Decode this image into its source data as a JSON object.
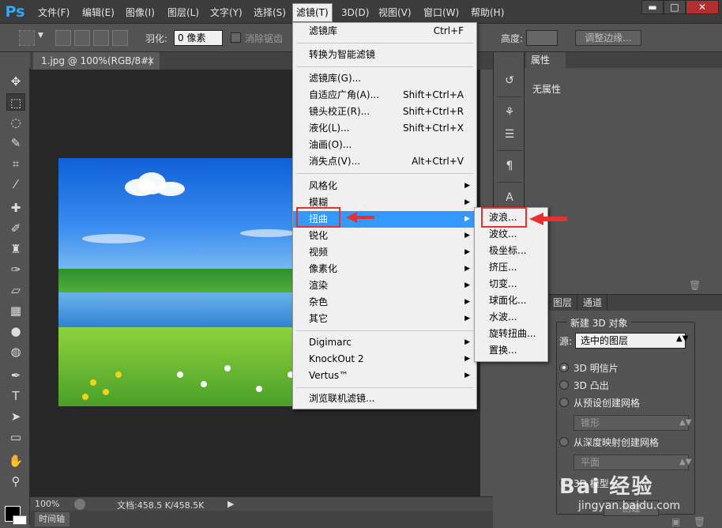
{
  "app": {
    "logo": "Ps"
  },
  "menubar": {
    "items": [
      "文件(F)",
      "编辑(E)",
      "图像(I)",
      "图层(L)",
      "文字(Y)",
      "选择(S)",
      "滤镜(T)",
      "3D(D)",
      "视图(V)",
      "窗口(W)",
      "帮助(H)"
    ],
    "active_index": 6
  },
  "window_controls": {
    "minimize": "▬",
    "maximize": "□",
    "close": "✕"
  },
  "options": {
    "feather_label": "羽化:",
    "feather_value": "0 像素",
    "antialias_label": "消除锯齿",
    "height_label": "高度:",
    "refine_edge_label": "调整边缘..."
  },
  "document": {
    "tab_title": "1.jpg @ 100%(RGB/8#)",
    "tab_close": "×",
    "zoom": "100%",
    "doc_info": "文档:458.5 K/458.5K",
    "timeline_tab": "时间轴"
  },
  "properties": {
    "tab": "属性",
    "body": "无属性"
  },
  "layers": {
    "tabs": [
      "图层",
      "通道"
    ],
    "create3d_title": "新建 3D 对象",
    "source_label": "源:",
    "source_value": "选中的图层",
    "options": [
      {
        "label": "3D 明信片",
        "selected": true
      },
      {
        "label": "3D 凸出",
        "selected": false
      },
      {
        "label": "从预设创建网格",
        "selected": false
      },
      {
        "label": "从深度映射创建网格",
        "selected": false
      }
    ],
    "preset_select": "锥形",
    "depth_select": "平面",
    "partial_label": "3D 模型",
    "create_btn": "创建"
  },
  "filter_menu": {
    "items": [
      {
        "label": "滤镜库",
        "shortcut": "Ctrl+F"
      },
      {
        "label": "转换为智能滤镜",
        "shortcut": ""
      },
      {
        "label": "滤镜库(G)...",
        "shortcut": ""
      },
      {
        "label": "自适应广角(A)...",
        "shortcut": "Shift+Ctrl+A"
      },
      {
        "label": "镜头校正(R)...",
        "shortcut": "Shift+Ctrl+R"
      },
      {
        "label": "液化(L)...",
        "shortcut": "Shift+Ctrl+X"
      },
      {
        "label": "油画(O)...",
        "shortcut": ""
      },
      {
        "label": "消失点(V)...",
        "shortcut": "Alt+Ctrl+V"
      },
      {
        "label": "风格化",
        "submenu": true
      },
      {
        "label": "模糊",
        "submenu": true
      },
      {
        "label": "扭曲",
        "submenu": true,
        "highlighted": true
      },
      {
        "label": "锐化",
        "submenu": true
      },
      {
        "label": "视频",
        "submenu": true
      },
      {
        "label": "像素化",
        "submenu": true
      },
      {
        "label": "渲染",
        "submenu": true
      },
      {
        "label": "杂色",
        "submenu": true
      },
      {
        "label": "其它",
        "submenu": true
      },
      {
        "label": "Digimarc",
        "submenu": true
      },
      {
        "label": "KnockOut 2",
        "submenu": true
      },
      {
        "label": "Vertus™",
        "submenu": true
      },
      {
        "label": "浏览联机滤镜..."
      }
    ]
  },
  "distort_submenu": {
    "items": [
      "波浪...",
      "波纹...",
      "极坐标...",
      "挤压...",
      "切变...",
      "球面化...",
      "水波...",
      "旋转扭曲...",
      "置换..."
    ]
  },
  "colors": {
    "menu_highlight": "#3399ff",
    "annotation_red": "#e8302f",
    "ps_blue": "#31a8ff"
  },
  "watermark": {
    "text": "Bai 经验",
    "url": "jingyan.baidu.com"
  }
}
